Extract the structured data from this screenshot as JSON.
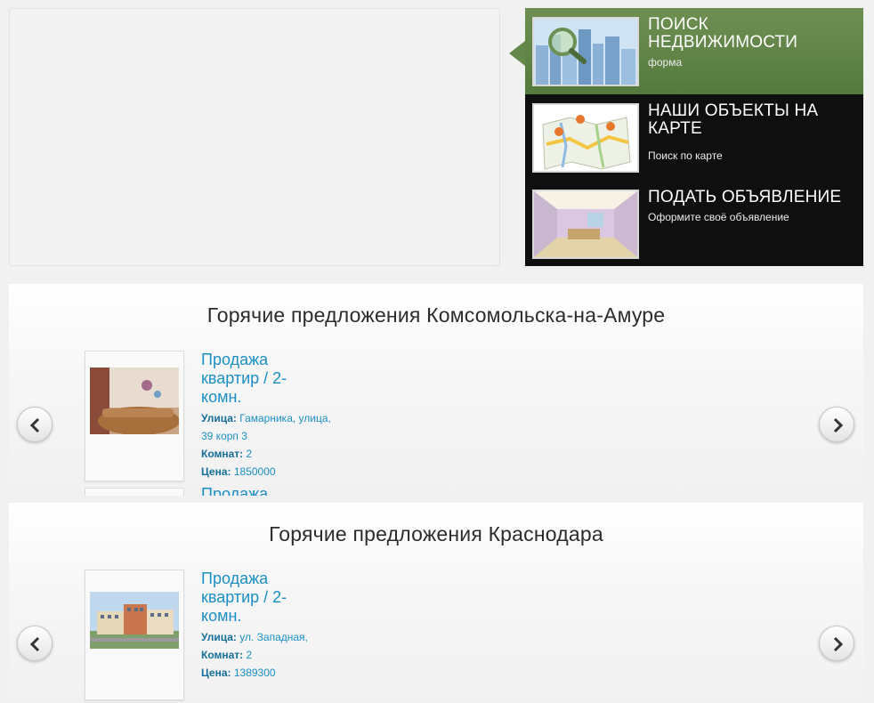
{
  "menu": {
    "items": [
      {
        "title": "Поиск недвижимости",
        "subtitle": "форма",
        "icon": "city-search-image"
      },
      {
        "title": "Наши объекты на карте",
        "subtitle": "Поиск по карте",
        "icon": "map-pins-image"
      },
      {
        "title": "Подать объявление",
        "subtitle": "Оформите своё объявление",
        "icon": "interior-sketch-image"
      }
    ],
    "active_color": "#64884a",
    "background_color": "#0f0f0f"
  },
  "sections": [
    {
      "title": "Горячие предложения Комсомольска-на-Амуре",
      "prev_icon": "chevron-left-icon",
      "next_icon": "chevron-right-icon",
      "card": {
        "title": "Продажа квартир / 2-комн.",
        "street_label": "Улица:",
        "street_value": "Гамарника, улица, 39 корп 3",
        "rooms_label": "Комнат:",
        "rooms_value": "2",
        "price_label": "Цена:",
        "price_value": "1850000"
      },
      "next_card_title": "Продажа"
    },
    {
      "title": "Горячие предложения Краснодара",
      "prev_icon": "chevron-left-icon",
      "next_icon": "chevron-right-icon",
      "card": {
        "title": "Продажа квартир / 2-комн.",
        "street_label": "Улица:",
        "street_value": "ул. Западная,",
        "rooms_label": "Комнат:",
        "rooms_value": "2",
        "price_label": "Цена:",
        "price_value": "1389300"
      }
    }
  ],
  "link_color": "#1b8fc4"
}
